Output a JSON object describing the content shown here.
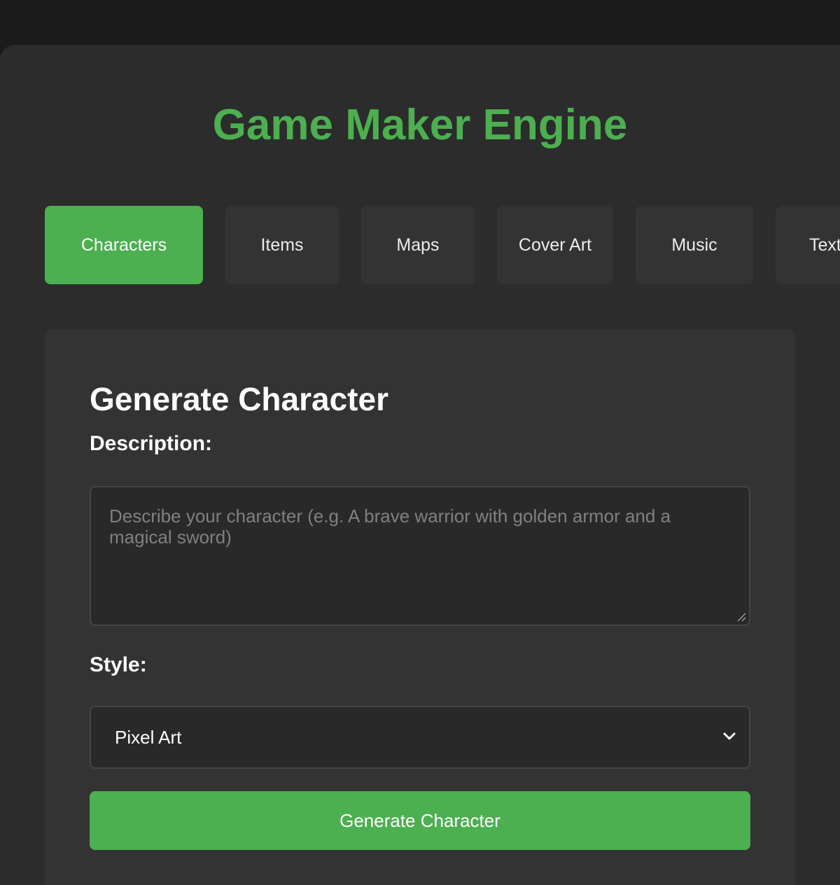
{
  "app": {
    "title": "Game Maker Engine"
  },
  "tabs": [
    {
      "label": "Characters",
      "active": true
    },
    {
      "label": "Items",
      "active": false
    },
    {
      "label": "Maps",
      "active": false
    },
    {
      "label": "Cover Art",
      "active": false
    },
    {
      "label": "Music",
      "active": false
    },
    {
      "label": "Text",
      "active": false
    }
  ],
  "panel": {
    "title": "Generate Character",
    "description_label": "Description:",
    "description_placeholder": "Describe your character (e.g. A brave warrior with golden armor and a magical sword)",
    "description_value": "",
    "style_label": "Style:",
    "style_selected": "Pixel Art",
    "generate_label": "Generate Character"
  },
  "icons": {
    "select_arrow": "chevron-down-icon",
    "textarea_resize": "resize-grip-icon"
  },
  "colors": {
    "accent": "#4caf50",
    "background": "#1b1b1b",
    "surface": "#2c2c2c",
    "panel": "#333333",
    "input": "#292929"
  }
}
